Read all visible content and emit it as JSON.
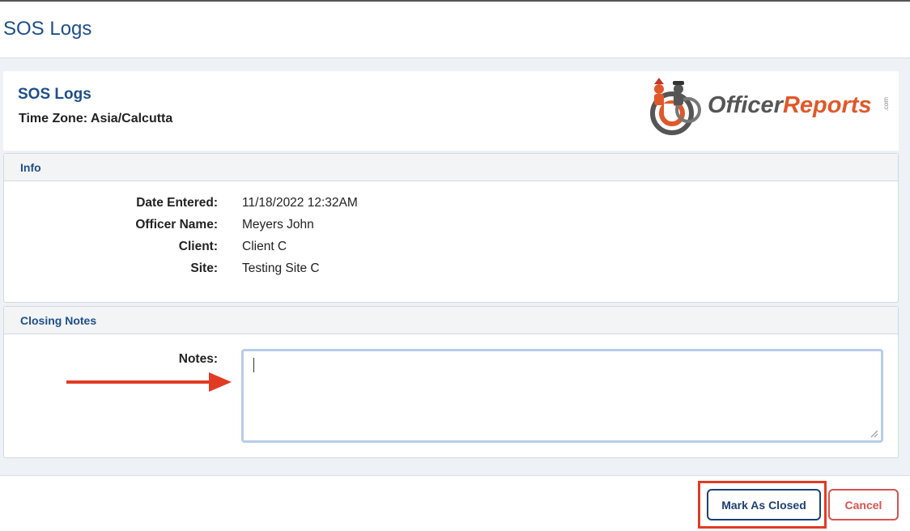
{
  "page": {
    "title": "SOS Logs"
  },
  "report": {
    "title": "SOS Logs",
    "time_zone": "Time Zone: Asia/Calcutta"
  },
  "logo": {
    "text_officer": "Officer",
    "text_reports": "Reports",
    "text_com": ".com"
  },
  "info": {
    "section_title": "Info",
    "fields": [
      {
        "label": "Date Entered:",
        "value": "11/18/2022 12:32AM"
      },
      {
        "label": "Officer Name:",
        "value": "Meyers John"
      },
      {
        "label": "Client:",
        "value": "Client C"
      },
      {
        "label": "Site:",
        "value": "Testing Site C"
      }
    ]
  },
  "closing_notes": {
    "section_title": "Closing Notes",
    "notes_label": "Notes:",
    "notes_value": ""
  },
  "actions": {
    "mark_closed_label": "Mark As Closed",
    "cancel_label": "Cancel"
  },
  "colors": {
    "brand_blue": "#1d4f8a",
    "annotation_red": "#e23b24",
    "cancel_red": "#d9534f",
    "logo_orange": "#e0582a"
  }
}
